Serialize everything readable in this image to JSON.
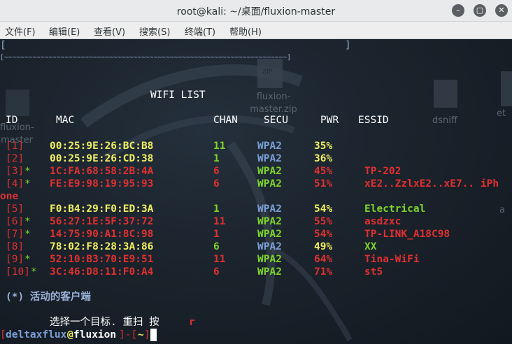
{
  "window": {
    "title": "root@kali: ~/桌面/fluxion-master",
    "controls": [
      "–",
      "▢",
      "✕"
    ]
  },
  "menu": [
    "文件(F)",
    "编辑(E)",
    "查看(V)",
    "搜索(S)",
    "终端(T)",
    "帮助(H)"
  ],
  "desktop_icons": {
    "zip_label": "ZIP",
    "zip_name_1": "fluxion-",
    "zip_name_2": "master.zip",
    "left_label_1": "fluxion-",
    "left_label_2": "master",
    "dsniff": "dsniff",
    "right_frag": "et",
    "right_frag2": "a"
  },
  "terminal": {
    "box_top_l": "[",
    "box_top_r": "]",
    "box_bottom": "[~~~~~~~~~~~~~~~~~~~~~~~~~~~~~~~~~~~~~~~~~~~~~~~~~~~~~~~~~~~~~~~~~~~~~~]",
    "list_title": "WIFI LIST",
    "headers": {
      "id": "ID",
      "mac": "MAC",
      "chan": "CHAN",
      "secu": "SECU",
      "pwr": "PWR",
      "essid": "ESSID"
    },
    "rows": [
      {
        "id": "[1]",
        "star": "",
        "mac": "00:25:9E:26:BC:B8",
        "chan": "11",
        "secu": "WPA2",
        "pwr": "35%",
        "essid": ""
      },
      {
        "id": "[2]",
        "star": "",
        "mac": "00:25:9E:26:CD:38",
        "chan": "1",
        "secu": "WPA2",
        "pwr": "36%",
        "essid": ""
      },
      {
        "id": "[3]",
        "star": "*",
        "mac": "1C:FA:68:58:2B:4A",
        "chan": "6",
        "secu": "WPA2",
        "pwr": "45%",
        "essid": "TP-202"
      },
      {
        "id": "[4]",
        "star": "*",
        "mac": "FE:E9:98:19:95:93",
        "chan": "6",
        "secu": "WPA2",
        "pwr": "51%",
        "essid": "xE2..ZzlxE2..xE7.. iPh"
      },
      {
        "id": "[5]",
        "star": "",
        "mac": "F0:B4:29:F0:ED:3A",
        "chan": "1",
        "secu": "WPA2",
        "pwr": "54%",
        "essid": "Electrical"
      },
      {
        "id": "[6]",
        "star": "*",
        "mac": "56:27:1E:5F:37:72",
        "chan": "11",
        "secu": "WPA2",
        "pwr": "55%",
        "essid": "asdzxc"
      },
      {
        "id": "[7]",
        "star": "*",
        "mac": "14:75:90:A1:8C:98",
        "chan": "1",
        "secu": "WPA2",
        "pwr": "54%",
        "essid": "TP-LINK_A18C98"
      },
      {
        "id": "[8]",
        "star": "",
        "mac": "78:02:F8:28:3A:86",
        "chan": "6",
        "secu": "WPA2",
        "pwr": "49%",
        "essid": "XX"
      },
      {
        "id": "[9]",
        "star": "*",
        "mac": "52:10:B3:70:E9:51",
        "chan": "11",
        "secu": "WPA2",
        "pwr": "64%",
        "essid": "Tina-WiFi"
      },
      {
        "id": "[10]",
        "star": "*",
        "mac": "3C:46:D8:11:F0:A4",
        "chan": "6",
        "secu": "WPA2",
        "pwr": "71%",
        "essid": "st5"
      }
    ],
    "wrap_text": "one",
    "active_clients": "(*) 活动的客户端",
    "prompt_msg": "选择一个目标. 重扫 按",
    "prompt_key": "r",
    "ps_open": "[",
    "ps_user": "deltaxflux",
    "ps_at": "@",
    "ps_host": "fluxion",
    "ps_mid": "]-[",
    "ps_path": "~",
    "ps_close": "]"
  },
  "colors": {
    "id_red": "#e03030",
    "mac_yellow": "#f0f060",
    "chan_green": "#7ed42c",
    "secu_blue": "#7a9fd6"
  }
}
